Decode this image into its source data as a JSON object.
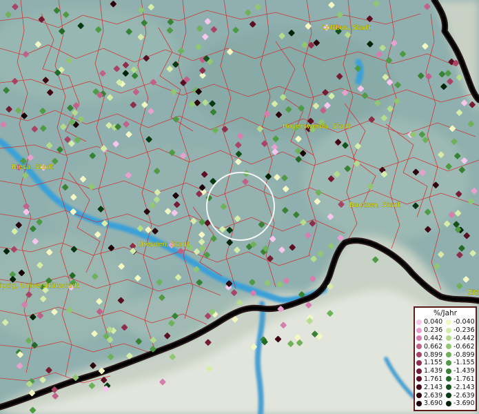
{
  "legend": {
    "title": "%/Jahr",
    "positive": [
      {
        "label": "0.040",
        "color": "#f6c6ec"
      },
      {
        "label": "0.236",
        "color": "#e8a1cf"
      },
      {
        "label": "0.442",
        "color": "#d67fae"
      },
      {
        "label": "0.662",
        "color": "#c06189"
      },
      {
        "label": "0.899",
        "color": "#a84466"
      },
      {
        "label": "1.155",
        "color": "#8e2e4a"
      },
      {
        "label": "1.439",
        "color": "#741c34"
      },
      {
        "label": "1.761",
        "color": "#5a0f22"
      },
      {
        "label": "2.143",
        "color": "#430714"
      },
      {
        "label": "2.639",
        "color": "#2c030b"
      },
      {
        "label": "3.690",
        "color": "#180005"
      }
    ],
    "negative": [
      {
        "label": "-0.040",
        "color": "#f2f7c4"
      },
      {
        "label": "-0.236",
        "color": "#d6ecaa"
      },
      {
        "label": "-0.442",
        "color": "#b5dc8c"
      },
      {
        "label": "-0.662",
        "color": "#91c772"
      },
      {
        "label": "-0.899",
        "color": "#6fb15a"
      },
      {
        "label": "-1.155",
        "color": "#4f9a45"
      },
      {
        "label": "-1.439",
        "color": "#378235"
      },
      {
        "label": "-1.761",
        "color": "#236a28"
      },
      {
        "label": "-2.143",
        "color": "#13521c"
      },
      {
        "label": "-2.639",
        "color": "#073a12"
      },
      {
        "label": "-3.690",
        "color": "#00240a"
      }
    ]
  },
  "cities": [
    {
      "name": "Cottbus, Stadt"
    },
    {
      "name": "Hoyerswerda, Stadt"
    },
    {
      "name": "Riesa, Stadt"
    },
    {
      "name": "Bautzen, Stadt"
    },
    {
      "name": "Dresden, Stadt"
    },
    {
      "name": "Leipzig, Universitätsstadt"
    },
    {
      "name": "Zittau"
    }
  ],
  "colors": {
    "terrain": "#8fb0ae",
    "mountains": "#d6dcd2",
    "border_line": "#111111",
    "district_lines": "#d42a2a",
    "water": "#3aa0d8",
    "city_text": "#e6e000",
    "highlight_circle": "#ffffff"
  },
  "icons": {
    "highlight": "circle-highlight-icon"
  }
}
